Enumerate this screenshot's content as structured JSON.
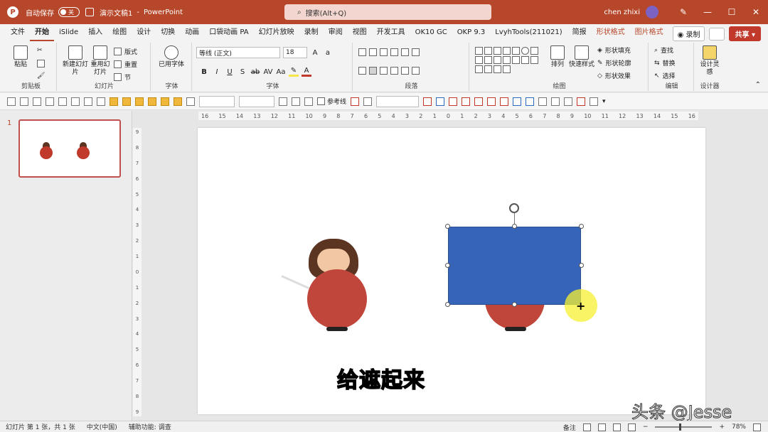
{
  "titlebar": {
    "autosave_label": "自动保存",
    "autosave_state": "关",
    "doc_name": "演示文稿1",
    "separator": "-",
    "app_name": "PowerPoint",
    "search_placeholder": "搜索(Alt+Q)",
    "user_name": "chen zhixi",
    "minimize": "—",
    "maximize": "☐",
    "close": "✕"
  },
  "tabs": [
    "文件",
    "开始",
    "iSlide",
    "插入",
    "绘图",
    "设计",
    "切换",
    "动画",
    "口袋动画 PA",
    "幻灯片放映",
    "录制",
    "审阅",
    "视图",
    "开发工具",
    "OK10 GC",
    "OKP 9.3",
    "LvyhTools(211021)",
    "简报",
    "形状格式",
    "图片格式"
  ],
  "tabs_right": {
    "record": "◉ 录制",
    "share": "共享 ▾"
  },
  "ribbon": {
    "clipboard": {
      "paste": "粘贴",
      "label": "剪贴板"
    },
    "slides": {
      "new_slide": "新建幻灯片",
      "reuse": "重用幻灯片",
      "layout": "版式",
      "reset": "重置",
      "section": "节",
      "label": "幻灯片"
    },
    "fonts": {
      "used_fonts": "已用字体",
      "label": "字体"
    },
    "font": {
      "family": "等线 (正文)",
      "size": "18",
      "label": "字体"
    },
    "paragraph": {
      "label": "段落"
    },
    "drawing": {
      "arrange": "排列",
      "quick_styles": "快速样式",
      "shape_fill": "形状填充",
      "shape_outline": "形状轮廓",
      "shape_effects": "形状效果",
      "label": "绘图"
    },
    "editing": {
      "find": "查找",
      "replace": "替换",
      "select": "选择",
      "label": "编辑"
    },
    "designer": {
      "design_ideas": "设计灵感",
      "label": "设计器"
    }
  },
  "toolbar2": {
    "guides_label": "参考线"
  },
  "thumbnail": {
    "number": "1"
  },
  "hruler_ticks": [
    "16",
    "15",
    "14",
    "13",
    "12",
    "11",
    "10",
    "9",
    "8",
    "7",
    "6",
    "5",
    "4",
    "3",
    "2",
    "1",
    "0",
    "1",
    "2",
    "3",
    "4",
    "5",
    "6",
    "7",
    "8",
    "9",
    "10",
    "11",
    "12",
    "13",
    "14",
    "15",
    "16"
  ],
  "vruler_ticks": [
    "9",
    "8",
    "7",
    "6",
    "5",
    "4",
    "3",
    "2",
    "1",
    "0",
    "1",
    "2",
    "3",
    "4",
    "5",
    "6",
    "7",
    "8",
    "9"
  ],
  "slide": {
    "subtitle": "给遮起来"
  },
  "watermark": "头条 @Jesse",
  "status": {
    "slide_info": "幻灯片 第 1 张，共 1 张",
    "language": "中文(中国)",
    "accessibility": "辅助功能: 调查",
    "notes": "备注",
    "zoom": "78%"
  },
  "colors": {
    "accent": "#b7472a",
    "shape_blue": "#3664b8",
    "body_red": "#c0453a",
    "cursor_highlight": "#f6f032"
  }
}
